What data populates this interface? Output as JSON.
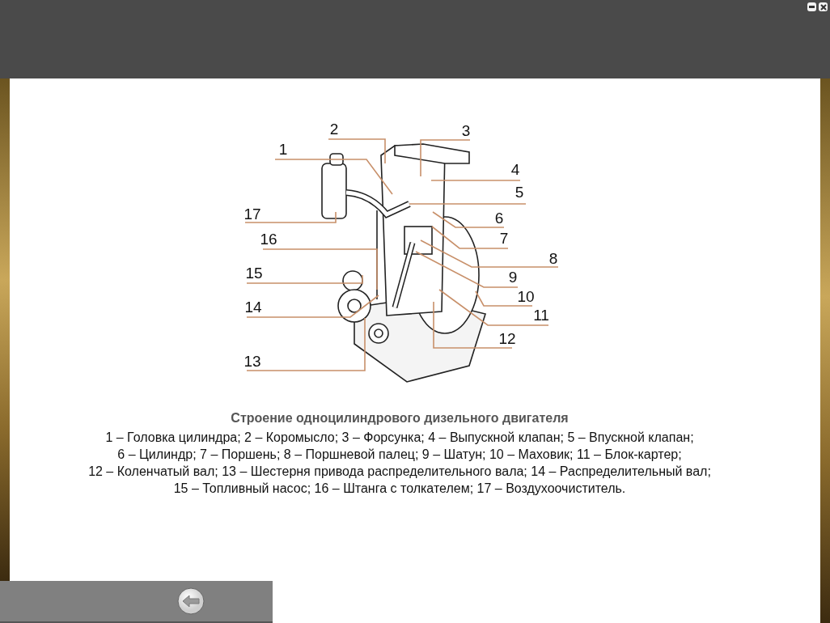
{
  "diagram": {
    "callouts": [
      {
        "number": "2"
      },
      {
        "number": "3"
      },
      {
        "number": "1"
      },
      {
        "number": "4"
      },
      {
        "number": "5"
      },
      {
        "number": "17"
      },
      {
        "number": "6"
      },
      {
        "number": "7"
      },
      {
        "number": "16"
      },
      {
        "number": "8"
      },
      {
        "number": "15"
      },
      {
        "number": "9"
      },
      {
        "number": "10"
      },
      {
        "number": "14"
      },
      {
        "number": "11"
      },
      {
        "number": "12"
      },
      {
        "number": "13"
      }
    ]
  },
  "caption": {
    "title": "Строение одноцилиндрового дизельного двигателя",
    "lines": [
      "1 – Головка цилиндра; 2 – Коромысло; 3 – Форсунка; 4 – Выпускной клапан; 5 – Впускной клапан;",
      "6 – Цилиндр; 7 – Поршень; 8 – Поршневой палец; 9 – Шатун; 10 – Маховик; 11 – Блок-картер;",
      "12 – Коленчатый вал; 13 – Шестерня привода распределительного вала; 14 – Распределительный вал;",
      "15 – Топливный насос; 16 – Штанга с толкателем; 17 – Воздухоочиститель."
    ]
  }
}
